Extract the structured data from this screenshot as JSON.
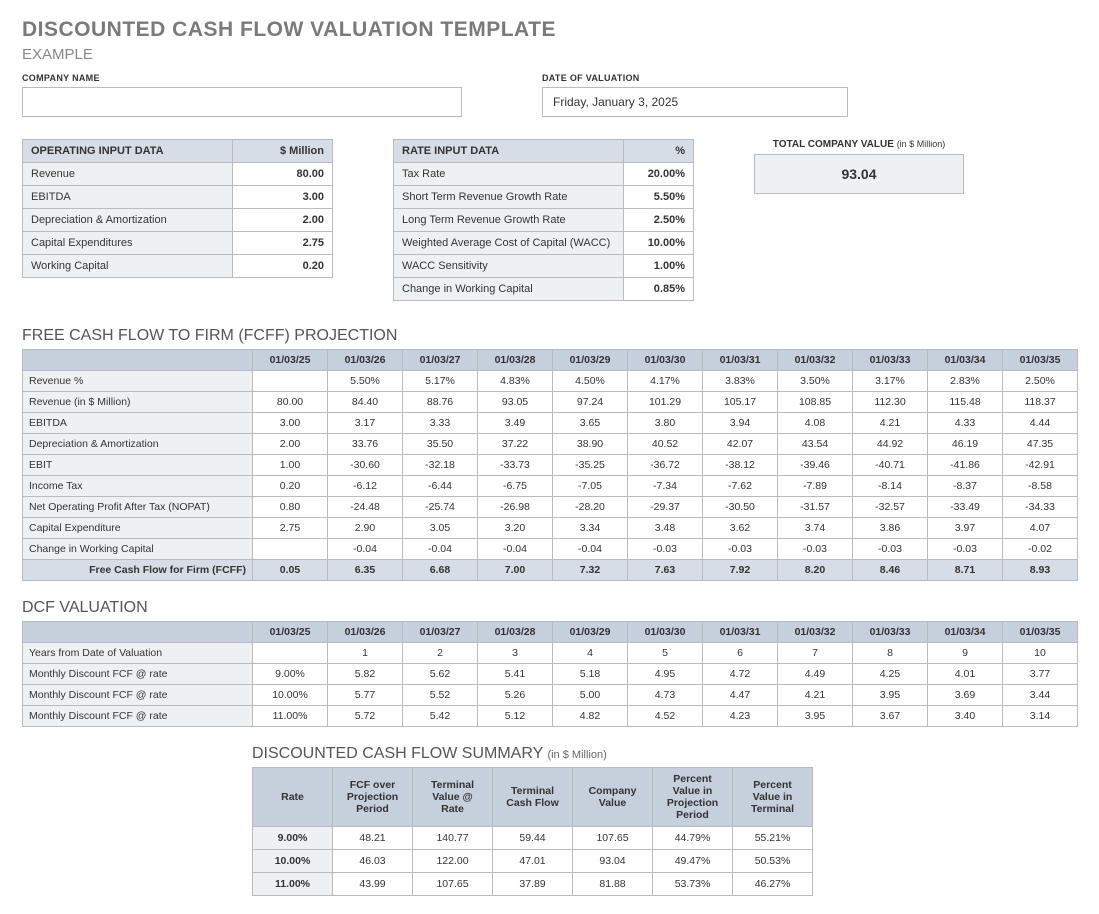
{
  "title": "DISCOUNTED CASH FLOW VALUATION TEMPLATE",
  "subtitle": "EXAMPLE",
  "fields": {
    "company_label": "COMPANY NAME",
    "company_value": "",
    "date_label": "DATE OF VALUATION",
    "date_value": "Friday, January 3, 2025"
  },
  "operating": {
    "header_label": "OPERATING INPUT DATA",
    "header_unit": "$ Million",
    "rows": [
      {
        "label": "Revenue",
        "value": "80.00"
      },
      {
        "label": "EBITDA",
        "value": "3.00"
      },
      {
        "label": "Depreciation & Amortization",
        "value": "2.00"
      },
      {
        "label": "Capital Expenditures",
        "value": "2.75"
      },
      {
        "label": "Working Capital",
        "value": "0.20"
      }
    ]
  },
  "rate": {
    "header_label": "RATE INPUT DATA",
    "header_unit": "%",
    "rows": [
      {
        "label": "Tax Rate",
        "value": "20.00%"
      },
      {
        "label": "Short Term Revenue Growth Rate",
        "value": "5.50%"
      },
      {
        "label": "Long Term Revenue Growth Rate",
        "value": "2.50%"
      },
      {
        "label": "Weighted Average Cost of Capital (WACC)",
        "value": "10.00%"
      },
      {
        "label": "WACC Sensitivity",
        "value": "1.00%"
      },
      {
        "label": "Change in Working Capital",
        "value": "0.85%"
      }
    ]
  },
  "tcv": {
    "label": "TOTAL COMPANY VALUE",
    "unit": "(in $ Million)",
    "value": "93.04"
  },
  "fcff": {
    "title": "FREE CASH FLOW TO FIRM (FCFF) PROJECTION",
    "dates": [
      "01/03/25",
      "01/03/26",
      "01/03/27",
      "01/03/28",
      "01/03/29",
      "01/03/30",
      "01/03/31",
      "01/03/32",
      "01/03/33",
      "01/03/34",
      "01/03/35"
    ],
    "rows": [
      {
        "label": "Revenue %",
        "vals": [
          "",
          "5.50%",
          "5.17%",
          "4.83%",
          "4.50%",
          "4.17%",
          "3.83%",
          "3.50%",
          "3.17%",
          "2.83%",
          "2.50%"
        ]
      },
      {
        "label": "Revenue (in $ Million)",
        "vals": [
          "80.00",
          "84.40",
          "88.76",
          "93.05",
          "97.24",
          "101.29",
          "105.17",
          "108.85",
          "112.30",
          "115.48",
          "118.37"
        ]
      },
      {
        "label": "EBITDA",
        "vals": [
          "3.00",
          "3.17",
          "3.33",
          "3.49",
          "3.65",
          "3.80",
          "3.94",
          "4.08",
          "4.21",
          "4.33",
          "4.44"
        ]
      },
      {
        "label": "Depreciation & Amortization",
        "vals": [
          "2.00",
          "33.76",
          "35.50",
          "37.22",
          "38.90",
          "40.52",
          "42.07",
          "43.54",
          "44.92",
          "46.19",
          "47.35"
        ]
      },
      {
        "label": "EBIT",
        "vals": [
          "1.00",
          "-30.60",
          "-32.18",
          "-33.73",
          "-35.25",
          "-36.72",
          "-38.12",
          "-39.46",
          "-40.71",
          "-41.86",
          "-42.91"
        ]
      },
      {
        "label": "Income Tax",
        "vals": [
          "0.20",
          "-6.12",
          "-6.44",
          "-6.75",
          "-7.05",
          "-7.34",
          "-7.62",
          "-7.89",
          "-8.14",
          "-8.37",
          "-8.58"
        ]
      },
      {
        "label": "Net Operating Profit After Tax (NOPAT)",
        "vals": [
          "0.80",
          "-24.48",
          "-25.74",
          "-26.98",
          "-28.20",
          "-29.37",
          "-30.50",
          "-31.57",
          "-32.57",
          "-33.49",
          "-34.33"
        ]
      },
      {
        "label": "Capital Expenditure",
        "vals": [
          "2.75",
          "2.90",
          "3.05",
          "3.20",
          "3.34",
          "3.48",
          "3.62",
          "3.74",
          "3.86",
          "3.97",
          "4.07"
        ]
      },
      {
        "label": "Change in Working Capital",
        "vals": [
          "",
          "-0.04",
          "-0.04",
          "-0.04",
          "-0.04",
          "-0.03",
          "-0.03",
          "-0.03",
          "-0.03",
          "-0.03",
          "-0.02"
        ]
      }
    ],
    "total": {
      "label": "Free Cash Flow for Firm (FCFF)",
      "vals": [
        "0.05",
        "6.35",
        "6.68",
        "7.00",
        "7.32",
        "7.63",
        "7.92",
        "8.20",
        "8.46",
        "8.71",
        "8.93"
      ]
    }
  },
  "dcf": {
    "title": "DCF VALUATION",
    "rows": [
      {
        "label": "Years from Date of Valuation",
        "vals": [
          "",
          "1",
          "2",
          "3",
          "4",
          "5",
          "6",
          "7",
          "8",
          "9",
          "10"
        ]
      },
      {
        "label": "Monthly Discount FCF @ rate",
        "vals": [
          "9.00%",
          "5.82",
          "5.62",
          "5.41",
          "5.18",
          "4.95",
          "4.72",
          "4.49",
          "4.25",
          "4.01",
          "3.77"
        ]
      },
      {
        "label": "Monthly Discount FCF @ rate",
        "vals": [
          "10.00%",
          "5.77",
          "5.52",
          "5.26",
          "5.00",
          "4.73",
          "4.47",
          "4.21",
          "3.95",
          "3.69",
          "3.44"
        ]
      },
      {
        "label": "Monthly Discount FCF @ rate",
        "vals": [
          "11.00%",
          "5.72",
          "5.42",
          "5.12",
          "4.82",
          "4.52",
          "4.23",
          "3.95",
          "3.67",
          "3.40",
          "3.14"
        ]
      }
    ]
  },
  "summary": {
    "title": "DISCOUNTED CASH FLOW SUMMARY",
    "unit": "(in $ Million)",
    "headers": [
      "Rate",
      "FCF over Projection Period",
      "Terminal Value @ Rate",
      "Terminal Cash Flow",
      "Company Value",
      "Percent Value in Projection Period",
      "Percent Value in Terminal"
    ],
    "rows": [
      [
        "9.00%",
        "48.21",
        "140.77",
        "59.44",
        "107.65",
        "44.79%",
        "55.21%"
      ],
      [
        "10.00%",
        "46.03",
        "122.00",
        "47.01",
        "93.04",
        "49.47%",
        "50.53%"
      ],
      [
        "11.00%",
        "43.99",
        "107.65",
        "37.89",
        "81.88",
        "53.73%",
        "46.27%"
      ]
    ]
  }
}
